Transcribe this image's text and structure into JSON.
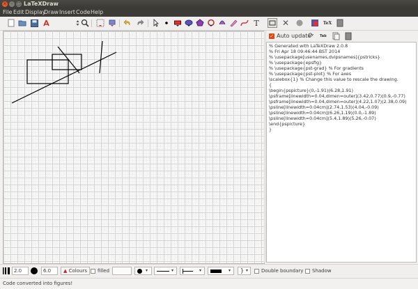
{
  "window": {
    "title": "LaTeXDraw",
    "controls": [
      "close",
      "minimize",
      "maximize"
    ]
  },
  "menu": {
    "items": [
      "File",
      "Edit",
      "Display",
      "Draw",
      "Insert",
      "Code",
      "Help"
    ]
  },
  "toolbar": {
    "zoom_value": "100",
    "icons": [
      "new-icon",
      "open-icon",
      "save-icon",
      "pdf-icon",
      "zoom-icon",
      "grid-icon",
      "export-icon",
      "undo-icon",
      "redo-icon",
      "pointer-icon",
      "dot-icon",
      "rectangle-icon",
      "ellipse-icon",
      "polygon-icon",
      "circle-icon",
      "arc-icon",
      "freehand-icon",
      "bezier-icon",
      "text-icon"
    ]
  },
  "code_panel": {
    "auto_update_label": "Auto update",
    "auto_update_checked": true,
    "lines": [
      "% Generated with LaTeXDraw 2.0.8",
      "% Fri Apr 18 09:46:44 BST 2014",
      "% \\usepackage[usenames,dvipsnames]{pstricks}",
      "% \\usepackage{epsfig}",
      "% \\usepackage{pst-grad} % For gradients",
      "% \\usepackage{pst-plot} % For axes",
      "\\scalebox{1} % Change this value to rescale the drawing.",
      "{",
      "\\begin{pspicture}(0,-1.91)(6.28,1.91)",
      "\\psframe[linewidth=0.04,dimen=outer](3.42,0.77)(0.9,-0.77)",
      "\\psframe[linewidth=0.04,dimen=outer](4.22,1.07)(2.38,0.09)",
      "\\psline[linewidth=0.04cm](2.74,1.53)(4.04,-0.09)",
      "\\psline[linewidth=0.04cm](6.26,1.19)(0.0,-1.89)",
      "\\psline[linewidth=0.04cm](5.4,1.89)(5.26,-0.07)",
      "\\end{pspicture}",
      "}"
    ]
  },
  "bottom": {
    "thickness": "2.0",
    "dot_size": "6.0",
    "colours_label": "Colours",
    "filled_label": "filled",
    "double_boundary_label": "Double boundary",
    "shadow_label": "Shadow"
  },
  "status": {
    "text": "Code converted into figures!"
  },
  "colors": {
    "titlebar": "#3c3b37",
    "close": "#e3582d",
    "accent": "#dd4814"
  }
}
